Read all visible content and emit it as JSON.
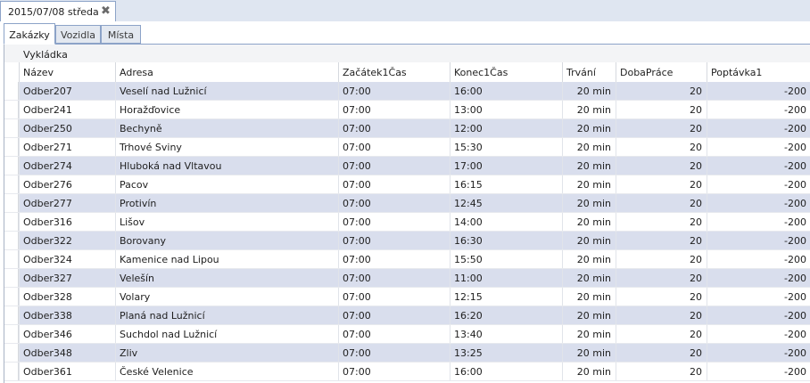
{
  "document_tab": {
    "title": "2015/07/08 středa",
    "close_glyph": "✖"
  },
  "subtabs": [
    {
      "label": "Zakázky",
      "active": true
    },
    {
      "label": "Vozidla",
      "active": false
    },
    {
      "label": "Místa",
      "active": false
    }
  ],
  "grid": {
    "group_panel_label": "Vykládka",
    "columns": [
      "Název",
      "Adresa",
      "Začátek1Čas",
      "Konec1Čas",
      "Trvání",
      "DobaPráce",
      "Poptávka1"
    ],
    "rows": [
      [
        "Odber207",
        "Veselí nad Lužnicí",
        "07:00",
        "16:00",
        "20 min",
        "20",
        "-200"
      ],
      [
        "Odber241",
        "Horažďovice",
        "07:00",
        "13:00",
        "20 min",
        "20",
        "-200"
      ],
      [
        "Odber250",
        "Bechyně",
        "07:00",
        "12:00",
        "20 min",
        "20",
        "-200"
      ],
      [
        "Odber271",
        "Trhové Sviny",
        "07:00",
        "15:30",
        "20 min",
        "20",
        "-200"
      ],
      [
        "Odber274",
        "Hluboká nad Vltavou",
        "07:00",
        "17:00",
        "20 min",
        "20",
        "-200"
      ],
      [
        "Odber276",
        "Pacov",
        "07:00",
        "16:15",
        "20 min",
        "20",
        "-200"
      ],
      [
        "Odber277",
        "Protivín",
        "07:00",
        "12:45",
        "20 min",
        "20",
        "-200"
      ],
      [
        "Odber316",
        "Lišov",
        "07:00",
        "14:00",
        "20 min",
        "20",
        "-200"
      ],
      [
        "Odber322",
        "Borovany",
        "07:00",
        "16:30",
        "20 min",
        "20",
        "-200"
      ],
      [
        "Odber324",
        "Kamenice nad Lipou",
        "07:00",
        "15:50",
        "20 min",
        "20",
        "-200"
      ],
      [
        "Odber327",
        "Velešín",
        "07:00",
        "11:00",
        "20 min",
        "20",
        "-200"
      ],
      [
        "Odber328",
        "Volary",
        "07:00",
        "12:15",
        "20 min",
        "20",
        "-200"
      ],
      [
        "Odber338",
        "Planá nad Lužnicí",
        "07:00",
        "16:20",
        "20 min",
        "20",
        "-200"
      ],
      [
        "Odber346",
        "Suchdol nad Lužnicí",
        "07:00",
        "13:40",
        "20 min",
        "20",
        "-200"
      ],
      [
        "Odber348",
        "Zliv",
        "07:00",
        "13:25",
        "20 min",
        "20",
        "-200"
      ],
      [
        "Odber361",
        "České Velenice",
        "07:00",
        "16:00",
        "20 min",
        "20",
        "-200"
      ]
    ]
  },
  "colors": {
    "alt_row": "#d9deed",
    "border": "#8ca3c8"
  }
}
